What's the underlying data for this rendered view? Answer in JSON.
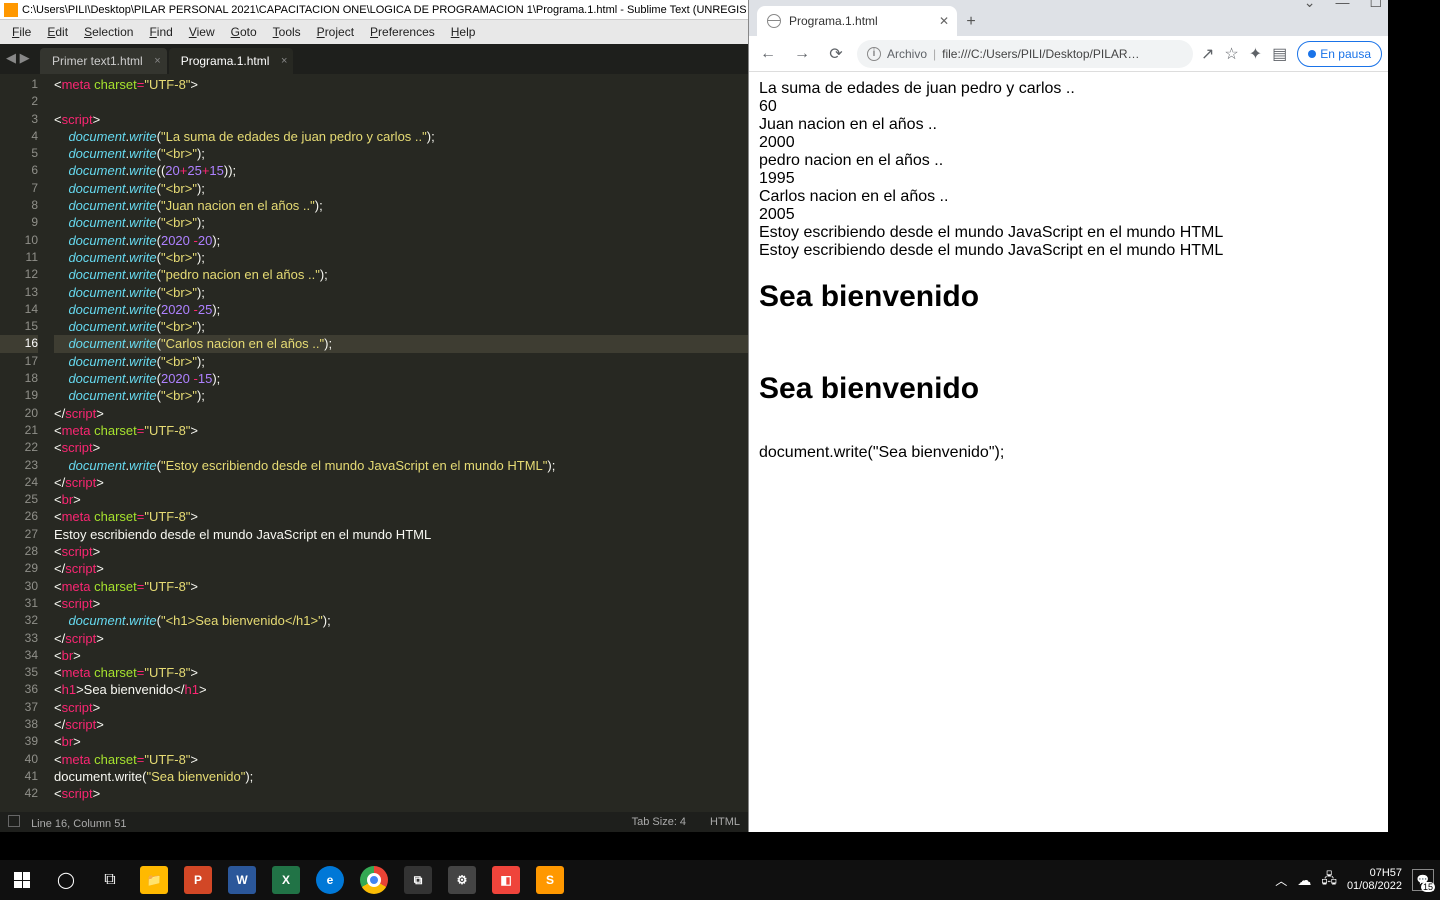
{
  "sublime": {
    "title_path": "C:\\Users\\PILI\\Desktop\\PILAR PERSONAL 2021\\CAPACITACION ONE\\LOGICA DE PROGRAMACION 1\\Programa.1.html - Sublime Text (UNREGIS",
    "menu": [
      "File",
      "Edit",
      "Selection",
      "Find",
      "View",
      "Goto",
      "Tools",
      "Project",
      "Preferences",
      "Help"
    ],
    "tabs": [
      {
        "label": "Primer text1.html",
        "active": false
      },
      {
        "label": "Programa.1.html",
        "active": true
      }
    ],
    "current_line": 16,
    "lines_count": 42,
    "code": [
      {
        "n": 1,
        "seg": [
          [
            "plain",
            "<"
          ],
          [
            "red",
            "meta"
          ],
          [
            "plain",
            " "
          ],
          [
            "attr",
            "charset"
          ],
          [
            "red",
            "="
          ],
          [
            "str",
            "\"UTF-8\""
          ],
          [
            "plain",
            ">"
          ]
        ]
      },
      {
        "n": 2,
        "seg": []
      },
      {
        "n": 3,
        "seg": [
          [
            "plain",
            "<"
          ],
          [
            "red",
            "script"
          ],
          [
            "plain",
            ">"
          ]
        ]
      },
      {
        "n": 4,
        "seg": [
          [
            "plain",
            "    "
          ],
          [
            "obj",
            "document"
          ],
          [
            "plain",
            "."
          ],
          [
            "func",
            "write"
          ],
          [
            "plain",
            "("
          ],
          [
            "str",
            "\"La suma de edades de juan pedro y carlos ..\""
          ],
          [
            "plain",
            ");"
          ]
        ]
      },
      {
        "n": 5,
        "seg": [
          [
            "plain",
            "    "
          ],
          [
            "obj",
            "document"
          ],
          [
            "plain",
            "."
          ],
          [
            "func",
            "write"
          ],
          [
            "plain",
            "("
          ],
          [
            "str",
            "\"<br>\""
          ],
          [
            "plain",
            ");"
          ]
        ]
      },
      {
        "n": 6,
        "seg": [
          [
            "plain",
            "    "
          ],
          [
            "obj",
            "document"
          ],
          [
            "plain",
            "."
          ],
          [
            "func",
            "write"
          ],
          [
            "plain",
            "(("
          ],
          [
            "num",
            "20"
          ],
          [
            "red",
            "+"
          ],
          [
            "num",
            "25"
          ],
          [
            "red",
            "+"
          ],
          [
            "num",
            "15"
          ],
          [
            "plain",
            "));"
          ]
        ]
      },
      {
        "n": 7,
        "seg": [
          [
            "plain",
            "    "
          ],
          [
            "obj",
            "document"
          ],
          [
            "plain",
            "."
          ],
          [
            "func",
            "write"
          ],
          [
            "plain",
            "("
          ],
          [
            "str",
            "\"<br>\""
          ],
          [
            "plain",
            ");"
          ]
        ]
      },
      {
        "n": 8,
        "seg": [
          [
            "plain",
            "    "
          ],
          [
            "obj",
            "document"
          ],
          [
            "plain",
            "."
          ],
          [
            "func",
            "write"
          ],
          [
            "plain",
            "("
          ],
          [
            "str",
            "\"Juan nacion en el años ..\""
          ],
          [
            "plain",
            ");"
          ]
        ]
      },
      {
        "n": 9,
        "seg": [
          [
            "plain",
            "    "
          ],
          [
            "obj",
            "document"
          ],
          [
            "plain",
            "."
          ],
          [
            "func",
            "write"
          ],
          [
            "plain",
            "("
          ],
          [
            "str",
            "\"<br>\""
          ],
          [
            "plain",
            ");"
          ]
        ]
      },
      {
        "n": 10,
        "seg": [
          [
            "plain",
            "    "
          ],
          [
            "obj",
            "document"
          ],
          [
            "plain",
            "."
          ],
          [
            "func",
            "write"
          ],
          [
            "plain",
            "("
          ],
          [
            "num",
            "2020"
          ],
          [
            "plain",
            " "
          ],
          [
            "red",
            "-"
          ],
          [
            "num",
            "20"
          ],
          [
            "plain",
            ");"
          ]
        ]
      },
      {
        "n": 11,
        "seg": [
          [
            "plain",
            "    "
          ],
          [
            "obj",
            "document"
          ],
          [
            "plain",
            "."
          ],
          [
            "func",
            "write"
          ],
          [
            "plain",
            "("
          ],
          [
            "str",
            "\"<br>\""
          ],
          [
            "plain",
            ");"
          ]
        ]
      },
      {
        "n": 12,
        "seg": [
          [
            "plain",
            "    "
          ],
          [
            "obj",
            "document"
          ],
          [
            "plain",
            "."
          ],
          [
            "func",
            "write"
          ],
          [
            "plain",
            "("
          ],
          [
            "str",
            "\"pedro nacion en el años ..\""
          ],
          [
            "plain",
            ");"
          ]
        ]
      },
      {
        "n": 13,
        "seg": [
          [
            "plain",
            "    "
          ],
          [
            "obj",
            "document"
          ],
          [
            "plain",
            "."
          ],
          [
            "func",
            "write"
          ],
          [
            "plain",
            "("
          ],
          [
            "str",
            "\"<br>\""
          ],
          [
            "plain",
            ");"
          ]
        ]
      },
      {
        "n": 14,
        "seg": [
          [
            "plain",
            "    "
          ],
          [
            "obj",
            "document"
          ],
          [
            "plain",
            "."
          ],
          [
            "func",
            "write"
          ],
          [
            "plain",
            "("
          ],
          [
            "num",
            "2020"
          ],
          [
            "plain",
            " "
          ],
          [
            "red",
            "-"
          ],
          [
            "num",
            "25"
          ],
          [
            "plain",
            ");"
          ]
        ]
      },
      {
        "n": 15,
        "seg": [
          [
            "plain",
            "    "
          ],
          [
            "obj",
            "document"
          ],
          [
            "plain",
            "."
          ],
          [
            "func",
            "write"
          ],
          [
            "plain",
            "("
          ],
          [
            "str",
            "\"<br>\""
          ],
          [
            "plain",
            ");"
          ]
        ]
      },
      {
        "n": 16,
        "seg": [
          [
            "plain",
            "    "
          ],
          [
            "obj",
            "document"
          ],
          [
            "plain",
            "."
          ],
          [
            "func",
            "write"
          ],
          [
            "plain",
            "("
          ],
          [
            "str",
            "\"Carlos nacion en el años ..\""
          ],
          [
            "plain",
            ");"
          ]
        ]
      },
      {
        "n": 17,
        "seg": [
          [
            "plain",
            "    "
          ],
          [
            "obj",
            "document"
          ],
          [
            "plain",
            "."
          ],
          [
            "func",
            "write"
          ],
          [
            "plain",
            "("
          ],
          [
            "str",
            "\"<br>\""
          ],
          [
            "plain",
            ");"
          ]
        ]
      },
      {
        "n": 18,
        "seg": [
          [
            "plain",
            "    "
          ],
          [
            "obj",
            "document"
          ],
          [
            "plain",
            "."
          ],
          [
            "func",
            "write"
          ],
          [
            "plain",
            "("
          ],
          [
            "num",
            "2020"
          ],
          [
            "plain",
            " "
          ],
          [
            "red",
            "-"
          ],
          [
            "num",
            "15"
          ],
          [
            "plain",
            ");"
          ]
        ]
      },
      {
        "n": 19,
        "seg": [
          [
            "plain",
            "    "
          ],
          [
            "obj",
            "document"
          ],
          [
            "plain",
            "."
          ],
          [
            "func",
            "write"
          ],
          [
            "plain",
            "("
          ],
          [
            "str",
            "\"<br>\""
          ],
          [
            "plain",
            ");"
          ]
        ]
      },
      {
        "n": 20,
        "seg": [
          [
            "plain",
            "</"
          ],
          [
            "red",
            "script"
          ],
          [
            "plain",
            ">"
          ]
        ]
      },
      {
        "n": 21,
        "seg": [
          [
            "plain",
            "<"
          ],
          [
            "red",
            "meta"
          ],
          [
            "plain",
            " "
          ],
          [
            "attr",
            "charset"
          ],
          [
            "red",
            "="
          ],
          [
            "str",
            "\"UTF-8\""
          ],
          [
            "plain",
            ">"
          ]
        ]
      },
      {
        "n": 22,
        "seg": [
          [
            "plain",
            "<"
          ],
          [
            "red",
            "script"
          ],
          [
            "plain",
            ">"
          ]
        ]
      },
      {
        "n": 23,
        "seg": [
          [
            "plain",
            "    "
          ],
          [
            "obj",
            "document"
          ],
          [
            "plain",
            "."
          ],
          [
            "func",
            "write"
          ],
          [
            "plain",
            "("
          ],
          [
            "str",
            "\"Estoy escribiendo desde el mundo JavaScript en el mundo HTML\""
          ],
          [
            "plain",
            ");"
          ]
        ]
      },
      {
        "n": 24,
        "seg": [
          [
            "plain",
            "</"
          ],
          [
            "red",
            "script"
          ],
          [
            "plain",
            ">"
          ]
        ]
      },
      {
        "n": 25,
        "seg": [
          [
            "plain",
            "<"
          ],
          [
            "red",
            "br"
          ],
          [
            "plain",
            ">"
          ]
        ]
      },
      {
        "n": 26,
        "seg": [
          [
            "plain",
            "<"
          ],
          [
            "red",
            "meta"
          ],
          [
            "plain",
            " "
          ],
          [
            "attr",
            "charset"
          ],
          [
            "red",
            "="
          ],
          [
            "str",
            "\"UTF-8\""
          ],
          [
            "plain",
            ">"
          ]
        ]
      },
      {
        "n": 27,
        "seg": [
          [
            "plain",
            "Estoy escribiendo desde el mundo JavaScript en el mundo HTML"
          ]
        ]
      },
      {
        "n": 28,
        "seg": [
          [
            "plain",
            "<"
          ],
          [
            "red",
            "script"
          ],
          [
            "plain",
            ">"
          ]
        ]
      },
      {
        "n": 29,
        "seg": [
          [
            "plain",
            "</"
          ],
          [
            "red",
            "script"
          ],
          [
            "plain",
            ">"
          ]
        ]
      },
      {
        "n": 30,
        "seg": [
          [
            "plain",
            "<"
          ],
          [
            "red",
            "meta"
          ],
          [
            "plain",
            " "
          ],
          [
            "attr",
            "charset"
          ],
          [
            "red",
            "="
          ],
          [
            "str",
            "\"UTF-8\""
          ],
          [
            "plain",
            ">"
          ]
        ]
      },
      {
        "n": 31,
        "seg": [
          [
            "plain",
            "<"
          ],
          [
            "red",
            "script"
          ],
          [
            "plain",
            ">"
          ]
        ]
      },
      {
        "n": 32,
        "seg": [
          [
            "plain",
            "    "
          ],
          [
            "obj",
            "document"
          ],
          [
            "plain",
            "."
          ],
          [
            "func",
            "write"
          ],
          [
            "plain",
            "("
          ],
          [
            "str",
            "\"<h1>Sea bienvenido</h1>\""
          ],
          [
            "plain",
            ");"
          ]
        ]
      },
      {
        "n": 33,
        "seg": [
          [
            "plain",
            "</"
          ],
          [
            "red",
            "script"
          ],
          [
            "plain",
            ">"
          ]
        ]
      },
      {
        "n": 34,
        "seg": [
          [
            "plain",
            "<"
          ],
          [
            "red",
            "br"
          ],
          [
            "plain",
            ">"
          ]
        ]
      },
      {
        "n": 35,
        "seg": [
          [
            "plain",
            "<"
          ],
          [
            "red",
            "meta"
          ],
          [
            "plain",
            " "
          ],
          [
            "attr",
            "charset"
          ],
          [
            "red",
            "="
          ],
          [
            "str",
            "\"UTF-8\""
          ],
          [
            "plain",
            ">"
          ]
        ]
      },
      {
        "n": 36,
        "seg": [
          [
            "plain",
            "<"
          ],
          [
            "red",
            "h1"
          ],
          [
            "plain",
            ">Sea bienvenido</"
          ],
          [
            "red",
            "h1"
          ],
          [
            "plain",
            ">"
          ]
        ]
      },
      {
        "n": 37,
        "seg": [
          [
            "plain",
            "<"
          ],
          [
            "red",
            "script"
          ],
          [
            "plain",
            ">"
          ]
        ]
      },
      {
        "n": 38,
        "seg": [
          [
            "plain",
            "</"
          ],
          [
            "red",
            "script"
          ],
          [
            "plain",
            ">"
          ]
        ]
      },
      {
        "n": 39,
        "seg": [
          [
            "plain",
            "<"
          ],
          [
            "red",
            "br"
          ],
          [
            "plain",
            ">"
          ]
        ]
      },
      {
        "n": 40,
        "seg": [
          [
            "plain",
            "<"
          ],
          [
            "red",
            "meta"
          ],
          [
            "plain",
            " "
          ],
          [
            "attr",
            "charset"
          ],
          [
            "red",
            "="
          ],
          [
            "str",
            "\"UTF-8\""
          ],
          [
            "plain",
            ">"
          ]
        ]
      },
      {
        "n": 41,
        "seg": [
          [
            "plain",
            "document.write("
          ],
          [
            "str",
            "\"Sea bienvenido\""
          ],
          [
            "plain",
            ");"
          ]
        ]
      },
      {
        "n": 42,
        "seg": [
          [
            "plain",
            "<"
          ],
          [
            "red",
            "script"
          ],
          [
            "plain",
            ">"
          ]
        ]
      }
    ],
    "status": {
      "left": "Line 16, Column 51",
      "tabsize": "Tab Size: 4",
      "lang": "HTML"
    }
  },
  "chrome": {
    "tab_title": "Programa.1.html",
    "omnibox_label": "Archivo",
    "omnibox_url": "file:///C:/Users/PILI/Desktop/PILAR…",
    "pause_label": "En pausa",
    "page_lines": [
      "La suma de edades de juan pedro y carlos ..",
      "60",
      "Juan nacion en el años ..",
      "2000",
      "pedro nacion en el años ..",
      "1995",
      "Carlos nacion en el años ..",
      "2005",
      "Estoy escribiendo desde el mundo JavaScript en el mundo HTML",
      "Estoy escribiendo desde el mundo JavaScript en el mundo HTML"
    ],
    "h1a": "Sea bienvenido",
    "h1b": "Sea bienvenido",
    "tail": "document.write(\"Sea bienvenido\");"
  },
  "taskbar": {
    "time": "07H57",
    "date": "01/08/2022",
    "notif_count": "15"
  }
}
